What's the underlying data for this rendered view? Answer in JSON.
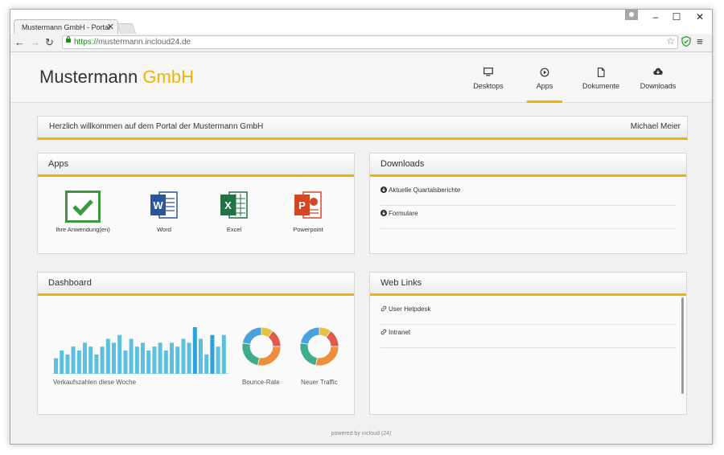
{
  "browser": {
    "tab_title": "Mustermann GmbH - Portal",
    "tab_close": "✕",
    "url_scheme": "https://",
    "url_rest": "mustermann.incloud24.de",
    "window_controls": [
      "–",
      "☐",
      "✕"
    ]
  },
  "site": {
    "logo_main": "Mustermann ",
    "logo_accent": "GmbH",
    "nav": [
      {
        "label": "Desktops",
        "icon": "monitor-icon",
        "active": false
      },
      {
        "label": "Apps",
        "icon": "play-circle-icon",
        "active": true
      },
      {
        "label": "Dokumente",
        "icon": "document-icon",
        "active": false
      },
      {
        "label": "Downloads",
        "icon": "cloud-download-icon",
        "active": false
      }
    ],
    "welcome": {
      "message": "Herzlich willkommen auf dem Portal der Mustermann GmbH",
      "user": "Michael Meier"
    },
    "apps": {
      "title": "Apps",
      "items": [
        {
          "label": "Ihre Anwendung(en)",
          "icon": "checkmark-icon",
          "color": "#3a9a3a"
        },
        {
          "label": "Word",
          "icon": "word-icon",
          "color": "#2b579a"
        },
        {
          "label": "Excel",
          "icon": "excel-icon",
          "color": "#217346"
        },
        {
          "label": "Powerpoint",
          "icon": "powerpoint-icon",
          "color": "#d24726"
        }
      ]
    },
    "downloads": {
      "title": "Downloads",
      "items": [
        "Aktuelle Quartalsberichte",
        "Formulare"
      ]
    },
    "dashboard": {
      "title": "Dashboard",
      "bar_label": "Verkaufszahlen diese Woche",
      "donut1_label": "Bounce-Rate",
      "donut2_label": "Neuer Traffic"
    },
    "weblinks": {
      "title": "Web Links",
      "items": [
        "User Helpdesk",
        "Intranet"
      ]
    },
    "footer": "powered by incloud (24)",
    "accent_color": "#f0b400"
  },
  "chart_data": [
    {
      "type": "bar",
      "values": [
        4,
        6,
        5,
        7,
        6,
        8,
        7,
        5,
        7,
        9,
        8,
        10,
        6,
        9,
        7,
        8,
        6,
        7,
        8,
        6,
        8,
        7,
        9,
        8,
        12,
        9,
        5,
        10,
        7,
        10
      ],
      "highlight_indices": [
        24,
        27
      ],
      "colors": {
        "normal": "#5bc0de",
        "highlight": "#2aa3d8"
      }
    },
    {
      "type": "pie",
      "values": [
        10,
        15,
        28,
        25,
        22
      ],
      "colors": [
        "#e8c13f",
        "#e15b4a",
        "#ef8f3c",
        "#3eab8c",
        "#4aa1db"
      ]
    },
    {
      "type": "pie",
      "values": [
        10,
        15,
        28,
        25,
        22
      ],
      "colors": [
        "#e8c13f",
        "#e15b4a",
        "#ef8f3c",
        "#3eab8c",
        "#4aa1db"
      ]
    }
  ]
}
